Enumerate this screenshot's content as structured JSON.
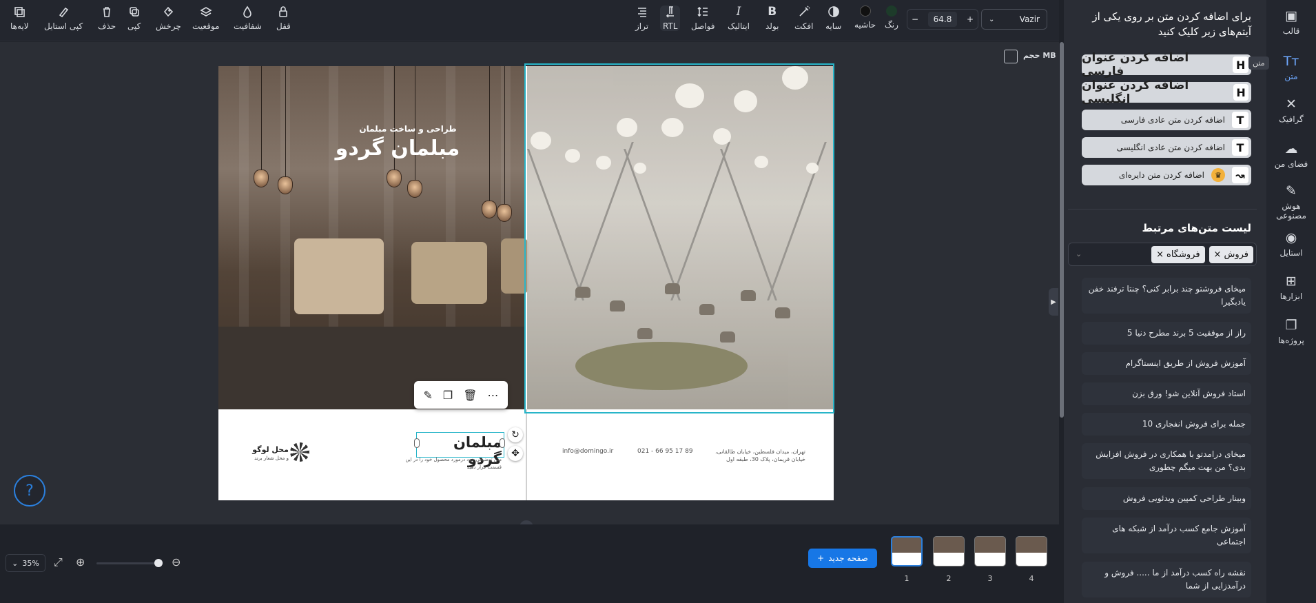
{
  "toolbar": {
    "left_tools": [
      {
        "label": "لایه‌ها",
        "icon": "layers-icon"
      },
      {
        "label": "کپی استایل",
        "icon": "paint-brush-icon"
      },
      {
        "label": "حذف",
        "icon": "trash-icon"
      },
      {
        "label": "کپی",
        "icon": "copy-icon"
      },
      {
        "label": "چرخش",
        "icon": "rotate-icon"
      },
      {
        "label": "موقعیت",
        "icon": "position-icon"
      },
      {
        "label": "شفافیت",
        "icon": "opacity-icon"
      },
      {
        "label": "قفل",
        "icon": "lock-icon"
      }
    ],
    "right_tools": [
      {
        "label": "تراز",
        "icon": "align-icon"
      },
      {
        "label": "RTL",
        "icon": "rtl-icon"
      },
      {
        "label": "فواصل",
        "icon": "spacing-icon"
      },
      {
        "label": "ایتالیک",
        "glyph": "I"
      },
      {
        "label": "بولد",
        "glyph": "B"
      },
      {
        "label": "افکت",
        "icon": "effect-icon"
      },
      {
        "label": "سایه",
        "icon": "shadow-icon"
      },
      {
        "label": "حاشیه",
        "icon": "border-icon"
      },
      {
        "label": "رنگ",
        "icon": "color-icon"
      }
    ],
    "font_size": "64.8",
    "font_size_minus": "−",
    "font_size_plus": "+",
    "font_family": "Vazir",
    "colors": {
      "border_swatch": "#111111",
      "text_swatch": "#1d3b2a"
    }
  },
  "canvas": {
    "size_label": "حجم MB",
    "left_subtitle": "طراحی و ساخت مبلمان",
    "left_title": "مبلمان گردو",
    "footer_title": "مبلمان گردو",
    "footer_desc": "متن توضیحی خود درمورد محصول خود را در این قسمت قرار دهید",
    "logo_text": "محل لوگو",
    "logo_sub": "و محل شعار برند",
    "contact_mail": "info@domingo.ir",
    "contact_phone": "021 - 66 95 17 89",
    "contact_address": "تهران، میدان فلسطین، خیابان طالقانی، خیابان قریمان، پلاک 30، طبقه اول",
    "float_actions": [
      {
        "icon": "edit-icon",
        "glyph": "✎"
      },
      {
        "icon": "duplicate-icon",
        "glyph": "❐"
      },
      {
        "icon": "delete-icon",
        "glyph": "🗑"
      },
      {
        "icon": "more-icon",
        "glyph": "⋯"
      }
    ]
  },
  "bottom": {
    "zoom": "35%",
    "new_page": "صفحه جدید",
    "pages": [
      "1",
      "2",
      "3",
      "4"
    ],
    "help": "?"
  },
  "panel": {
    "hint": "برای اضافه کردن متن بر روی یکی از آیتم‌های زیر کلیک کنید",
    "add_buttons": [
      {
        "label": "اضافه کردن عنوان فارسی",
        "icon": "H",
        "size": "big"
      },
      {
        "label": "اضافه کردن عنوان انگلیسی",
        "icon": "H",
        "size": "big"
      },
      {
        "label": "اضافه کردن متن عادی فارسی",
        "icon": "T",
        "size": "small"
      },
      {
        "label": "اضافه کردن متن عادی انگلیسی",
        "icon": "T",
        "size": "small"
      },
      {
        "label": "اضافه کردن متن دایره‌ای",
        "icon": "↝",
        "size": "small"
      }
    ],
    "list_title": "لیست متن‌های مرتبط",
    "tags": [
      "فروش",
      "فروشگاه"
    ],
    "related": [
      "میخای فروشتو چند برابر کنی؟ چنتا ترفند خفن یادبگیرا",
      "5 راز از موفقیت 5 برند مطرح دنیا",
      "آموزش فروش از طریق اینستاگرام",
      "استاد فروش آنلاین شو! ورق بزن",
      "10 جمله برای فروش انفجاری",
      "میخای درامدتو با همکاری در فروش افزایش بدی؟ من بهت میگم چطوری",
      "وبینار طراحی کمپین ویدئویی فروش",
      "آموزش جامع کسب درآمد از شبکه های اجتماعی",
      "نقشه راه کسب درآمد از ما ..... فروش و درآمدزایی از شما"
    ]
  },
  "nav": {
    "items": [
      {
        "label": "قالب",
        "icon": "template-icon",
        "glyph": "▣"
      },
      {
        "label": "متن",
        "icon": "text-icon",
        "glyph": "Tт"
      },
      {
        "label": "گرافیک",
        "icon": "graphic-icon",
        "glyph": "✕"
      },
      {
        "label": "فضای من",
        "icon": "upload-icon",
        "glyph": "☁"
      },
      {
        "label": "هوش مصنوعی",
        "icon": "ai-icon",
        "glyph": "✎"
      },
      {
        "label": "استایل",
        "icon": "palette-icon",
        "glyph": "◉"
      },
      {
        "label": "ابزارها",
        "icon": "tools-icon",
        "glyph": "⊞"
      },
      {
        "label": "پروژه‌ها",
        "icon": "projects-icon",
        "glyph": "❐"
      }
    ],
    "tooltip": "متن"
  }
}
